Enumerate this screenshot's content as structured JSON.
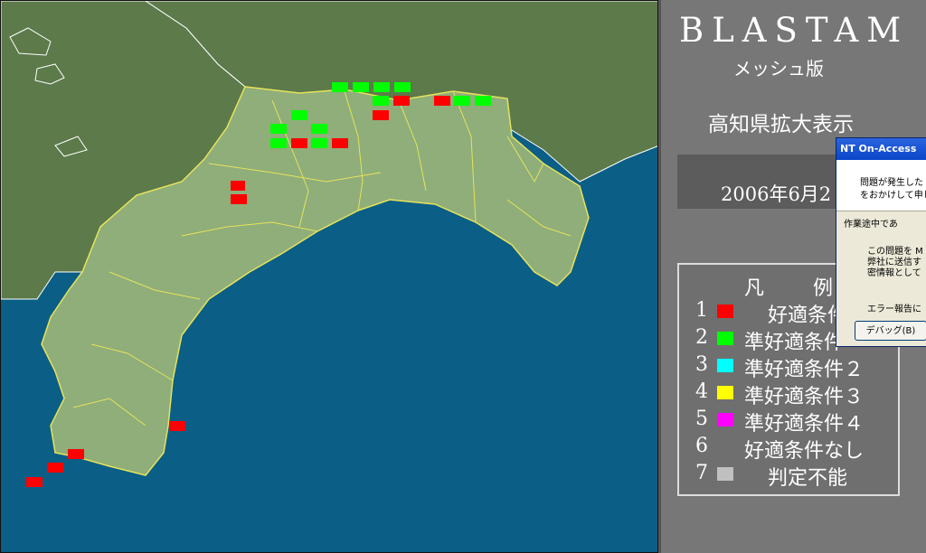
{
  "panel": {
    "app_title": "BLASTAM",
    "app_subtitle": "メッシュ版",
    "prefecture_label": "高知県拡大表示",
    "date_text": "2006年6月2"
  },
  "legend": {
    "title": "凡例",
    "items": [
      {
        "num": "1",
        "color": "#ff0000",
        "label": "好適条件"
      },
      {
        "num": "2",
        "color": "#00ff00",
        "label": "準好適条件"
      },
      {
        "num": "3",
        "color": "#00ffff",
        "label": "準好適条件２"
      },
      {
        "num": "4",
        "color": "#ffff00",
        "label": "準好適条件３"
      },
      {
        "num": "5",
        "color": "#ff00ff",
        "label": "準好適条件４"
      },
      {
        "num": "6",
        "color": "#777777",
        "label": "好適条件なし"
      },
      {
        "num": "7",
        "color": "#c0c0c0",
        "label": "判定不能"
      }
    ]
  },
  "dialog": {
    "title": "NT On-Access",
    "line1": "問題が発生した",
    "line2": "をおかけして申し",
    "line3": "作業途中であ",
    "line4": "この問題を M",
    "line5": "弊社に送信す",
    "line6": "密情報として",
    "line7": "エラー報告に",
    "debug_button": "デバッグ(B)"
  },
  "map": {
    "colors": {
      "sea": "#0b5e86",
      "land": "#5c7a4a",
      "kochi": "#8fae7a",
      "border": "#e6e35a",
      "optimal": "#ff0000",
      "semi_optimal": "#00ff00"
    }
  }
}
